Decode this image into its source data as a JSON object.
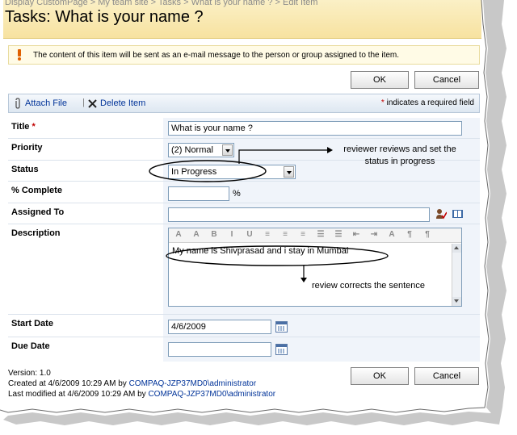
{
  "breadcrumb": "Display CustomPage > My team site > Tasks > What is your name ? > Edit Item",
  "title": "Tasks: What is your name ?",
  "info_message": "The content of this item will be sent as an e-mail message to the person or group assigned to the item.",
  "buttons": {
    "ok": "OK",
    "cancel": "Cancel"
  },
  "toolbar": {
    "attach_file": "Attach File",
    "separator": "|",
    "delete_item": "Delete Item",
    "required_star": "*",
    "required_text": "indicates a required field"
  },
  "form": {
    "title": {
      "label": "Title",
      "required": "*",
      "value": "What is your name ?"
    },
    "priority": {
      "label": "Priority",
      "value": "(2) Normal"
    },
    "status": {
      "label": "Status",
      "value": "In Progress"
    },
    "percent_complete": {
      "label": "% Complete",
      "value": "",
      "unit": "%"
    },
    "assigned_to": {
      "label": "Assigned To",
      "value": ""
    },
    "description": {
      "label": "Description",
      "value": "My name is Shivprasad and i stay in Mumbai"
    },
    "start_date": {
      "label": "Start Date",
      "value": "4/6/2009"
    },
    "due_date": {
      "label": "Due Date",
      "value": ""
    }
  },
  "rte_toolbar": [
    "A",
    "A",
    "B",
    "I",
    "U",
    "≡",
    "≡",
    "≡",
    "☰",
    "☰",
    "⇤",
    "⇥",
    "A",
    "¶",
    "¶"
  ],
  "footer": {
    "version": "Version: 1.0",
    "created_prefix": "Created at 4/6/2009 10:29 AM  by",
    "created_by": "COMPAQ-JZP37MD0\\administrator",
    "modified_prefix": "Last modified at 4/6/2009 10:29 AM  by",
    "modified_by": "COMPAQ-JZP37MD0\\administrator"
  },
  "annotations": {
    "status_note_line1": "reviewer reviews and set the",
    "status_note_line2": "status in progress",
    "description_note": "review corrects the sentence"
  },
  "colors": {
    "header": "#f7e2a0",
    "link": "#003399",
    "required": "#c00000",
    "field_bg": "#f0f4fa"
  }
}
